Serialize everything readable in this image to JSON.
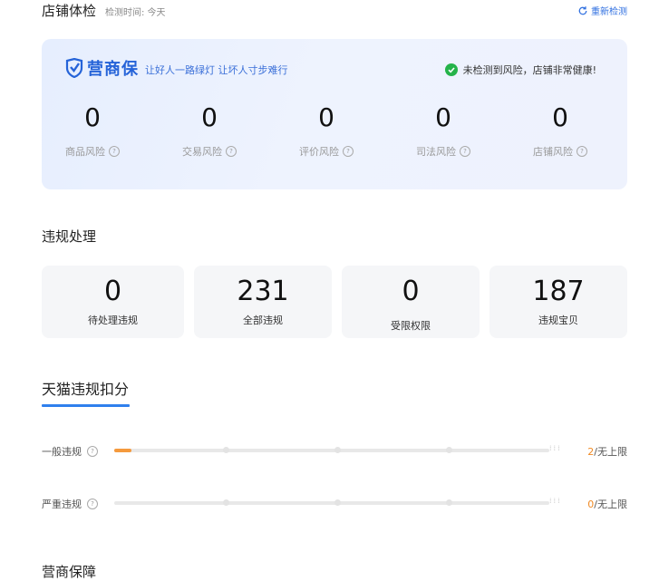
{
  "header": {
    "title": "店铺体检",
    "check_time_label": "检测时间: 今天",
    "recheck_label": "重新检测"
  },
  "health_card": {
    "logo_text": "营商保",
    "slogan": "让好人一路绿灯 让坏人寸步难行",
    "status_text": "未检测到风险，店铺非常健康!",
    "risks": [
      {
        "value": "0",
        "label": "商品风险"
      },
      {
        "value": "0",
        "label": "交易风险"
      },
      {
        "value": "0",
        "label": "评价风险"
      },
      {
        "value": "0",
        "label": "司法风险"
      },
      {
        "value": "0",
        "label": "店铺风险"
      }
    ]
  },
  "violations": {
    "title": "违规处理",
    "items": [
      {
        "value": "0",
        "label": "待处理违规"
      },
      {
        "value": "231",
        "label": "全部违规"
      },
      {
        "value": "0",
        "label": "受限权限"
      },
      {
        "value": "187",
        "label": "违规宝贝"
      }
    ]
  },
  "tmall": {
    "title": "天猫违规扣分",
    "rows": [
      {
        "label": "一般违规",
        "score": "2",
        "limit": "/无上限",
        "progress": 0.04
      },
      {
        "label": "严重违规",
        "score": "0",
        "limit": "/无上限",
        "progress": 0
      }
    ]
  },
  "guarantee": {
    "title": "营商保障"
  },
  "colors": {
    "accent": "#2f80ed",
    "brand_blue": "#2563d8",
    "ok_green": "#25b34a",
    "warning_orange": "#f08a24"
  }
}
